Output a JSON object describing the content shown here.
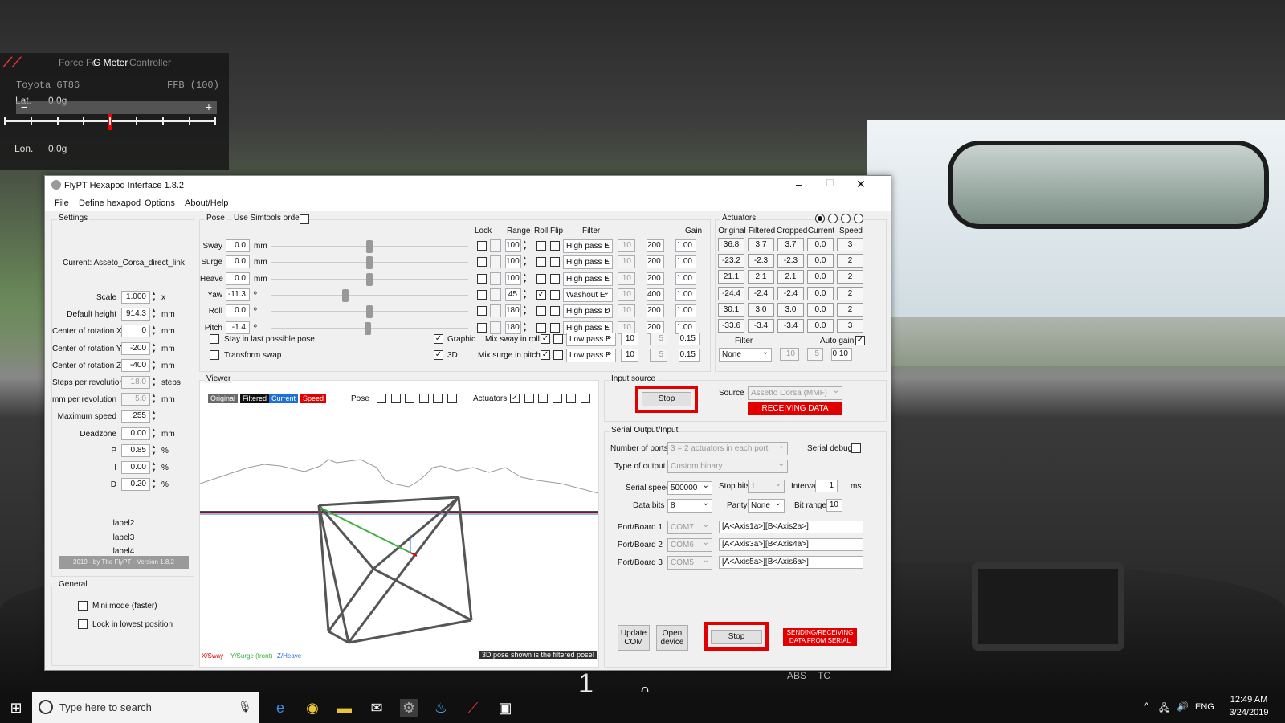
{
  "game": {
    "dash_abs": "ABS",
    "dash_tc": "TC",
    "gear": "1",
    "speed": "0"
  },
  "gmeter": {
    "tabs": [
      "Force Fe",
      "G Meter",
      "Controller"
    ],
    "car": "Toyota GT86",
    "ffb": "FFB (100)",
    "lat_label": "Lat.",
    "lat_value": "0.0g",
    "lon_label": "Lon.",
    "lon_value": "0.0g",
    "lat_level": 0.5
  },
  "window": {
    "title": "FlyPT Hexapod Interface 1.8.2",
    "menu": [
      "File",
      "Define hexapod",
      "Options",
      "About/Help"
    ]
  },
  "settings": {
    "title": "Settings",
    "current": "Current: Asseto_Corsa_direct_link",
    "fields": [
      {
        "label": "Scale",
        "value": "1.000",
        "unit": "x",
        "disabled": false
      },
      {
        "label": "Default height",
        "value": "914.3",
        "unit": "mm",
        "disabled": false
      },
      {
        "label": "Center of rotation X",
        "value": "0",
        "unit": "mm",
        "disabled": false
      },
      {
        "label": "Center of rotation Y",
        "value": "-200",
        "unit": "mm",
        "disabled": false
      },
      {
        "label": "Center of rotation Z",
        "value": "-400",
        "unit": "mm",
        "disabled": false
      },
      {
        "label": "Steps per revolution",
        "value": "18.0",
        "unit": "steps",
        "disabled": true
      },
      {
        "label": "mm per revolution",
        "value": "5.0",
        "unit": "mm",
        "disabled": true
      },
      {
        "label": "Maximum speed",
        "value": "255",
        "unit": "",
        "disabled": false
      },
      {
        "label": "Deadzone",
        "value": "0.00",
        "unit": "mm",
        "disabled": false
      },
      {
        "label": "P",
        "value": "0.85",
        "unit": "%",
        "disabled": false
      },
      {
        "label": "I",
        "value": "0.00",
        "unit": "%",
        "disabled": false
      },
      {
        "label": "D",
        "value": "0.20",
        "unit": "%",
        "disabled": false
      }
    ],
    "labels": [
      "label2",
      "label3",
      "label4"
    ],
    "footer": "2019 - by The FlyPT - Version 1.8.2"
  },
  "general": {
    "title": "General",
    "mini_mode": "Mini mode (faster)",
    "lock_lowest": "Lock in lowest position"
  },
  "pose": {
    "title": "Pose",
    "use_simtools": "Use Simtools order",
    "headers": {
      "lock": "Lock",
      "range": "Range",
      "roll": "Roll",
      "flip": "Flip",
      "filter": "Filter",
      "gain": "Gain"
    },
    "rows": [
      {
        "name": "Sway",
        "value": "0.0",
        "unit": "mm",
        "range": "100",
        "roll": false,
        "filter": "High pass E",
        "p1": "10",
        "p2": "200",
        "gain": "1.00",
        "slider": 0.5
      },
      {
        "name": "Surge",
        "value": "0.0",
        "unit": "mm",
        "range": "100",
        "roll": false,
        "filter": "High pass E",
        "p1": "10",
        "p2": "200",
        "gain": "1.00",
        "slider": 0.5
      },
      {
        "name": "Heave",
        "value": "0.0",
        "unit": "mm",
        "range": "100",
        "roll": false,
        "filter": "High pass E",
        "p1": "10",
        "p2": "200",
        "gain": "1.00",
        "slider": 0.5
      },
      {
        "name": "Yaw",
        "value": "-11.3",
        "unit": "º",
        "range": "45",
        "roll": true,
        "filter": "Washout E",
        "p1": "10",
        "p2": "400",
        "gain": "1.00",
        "slider": 0.38
      },
      {
        "name": "Roll",
        "value": "0.0",
        "unit": "º",
        "range": "180",
        "roll": false,
        "filter": "High pass D",
        "p1": "10",
        "p2": "200",
        "gain": "1.00",
        "slider": 0.5
      },
      {
        "name": "Pitch",
        "value": "-1.4",
        "unit": "º",
        "range": "180",
        "roll": false,
        "filter": "High pass E",
        "p1": "10",
        "p2": "200",
        "gain": "1.00",
        "slider": 0.49
      }
    ],
    "stay_last": "Stay in last possible pose",
    "transform_swap": "Transform swap",
    "graphic": "Graphic",
    "three_d": "3D",
    "mix_sway": {
      "label": "Mix sway in roll",
      "filter": "Low pass E",
      "p1": "10",
      "p2": "5",
      "gain": "0.15"
    },
    "mix_surge": {
      "label": "Mix surge in pitch",
      "filter": "Low pass E",
      "p1": "10",
      "p2": "5",
      "gain": "0.15"
    }
  },
  "actuators": {
    "title": "Actuators",
    "headers": [
      "Original",
      "Filtered",
      "Cropped",
      "Current",
      "Speed"
    ],
    "rows": [
      [
        "36.8",
        "3.7",
        "3.7",
        "0.0",
        "3"
      ],
      [
        "-23.2",
        "-2.3",
        "-2.3",
        "0.0",
        "2"
      ],
      [
        "21.1",
        "2.1",
        "2.1",
        "0.0",
        "2"
      ],
      [
        "-24.4",
        "-2.4",
        "-2.4",
        "0.0",
        "2"
      ],
      [
        "30.1",
        "3.0",
        "3.0",
        "0.0",
        "2"
      ],
      [
        "-33.6",
        "-3.4",
        "-3.4",
        "0.0",
        "3"
      ]
    ],
    "filter_label": "Filter",
    "filter_value": "None",
    "f1": "10",
    "f2": "5",
    "f3": "0.10",
    "auto_gain": "Auto gain"
  },
  "viewer": {
    "title": "Viewer",
    "tags": [
      "Original",
      "Filtered",
      "Current",
      "Speed"
    ],
    "pose_label": "Pose",
    "actuators_label": "Actuators",
    "axis_x": "X/Sway",
    "axis_y": "Y/Surge (front)",
    "axis_z": "Z/Heave",
    "note": "3D pose shown is the filtered pose!"
  },
  "input": {
    "title": "Input source",
    "stop": "Stop",
    "source_label": "Source",
    "source_value": "Assetto Corsa (MMF)",
    "status": "RECEIVING DATA"
  },
  "serial": {
    "title": "Serial Output/Input",
    "ports_label": "Number of ports",
    "ports_value": "3 = 2 actuators in each port",
    "serial_debug": "Serial debug",
    "type_label": "Type of output",
    "type_value": "Custom binary",
    "speed_label": "Serial speed",
    "speed_value": "500000",
    "stopbits_label": "Stop bits",
    "stopbits_value": "1",
    "interval_label": "Interval",
    "interval_value": "1",
    "interval_unit": "ms",
    "databits_label": "Data bits",
    "databits_value": "8",
    "parity_label": "Parity",
    "parity_value": "None",
    "bitrange_label": "Bit range",
    "bitrange_value": "10",
    "ports": [
      {
        "label": "Port/Board 1",
        "com": "COM7",
        "string": "[A<Axis1a>][B<Axis2a>]"
      },
      {
        "label": "Port/Board 2",
        "com": "COM6",
        "string": "[A<Axis3a>][B<Axis4a>]"
      },
      {
        "label": "Port/Board 3",
        "com": "COM5",
        "string": "[A<Axis5a>][B<Axis6a>]"
      }
    ],
    "update_com": "Update COM",
    "open_device": "Open device",
    "stop": "Stop",
    "status": "SENDING/RECEIVING DATA FROM SERIAL"
  },
  "taskbar": {
    "search_placeholder": "Type here to search",
    "lang": "ENG",
    "time": "12:49 AM",
    "date": "3/24/2019"
  },
  "colors": {
    "accent_red": "#e00000",
    "current_blue": "#1e6fd9"
  }
}
